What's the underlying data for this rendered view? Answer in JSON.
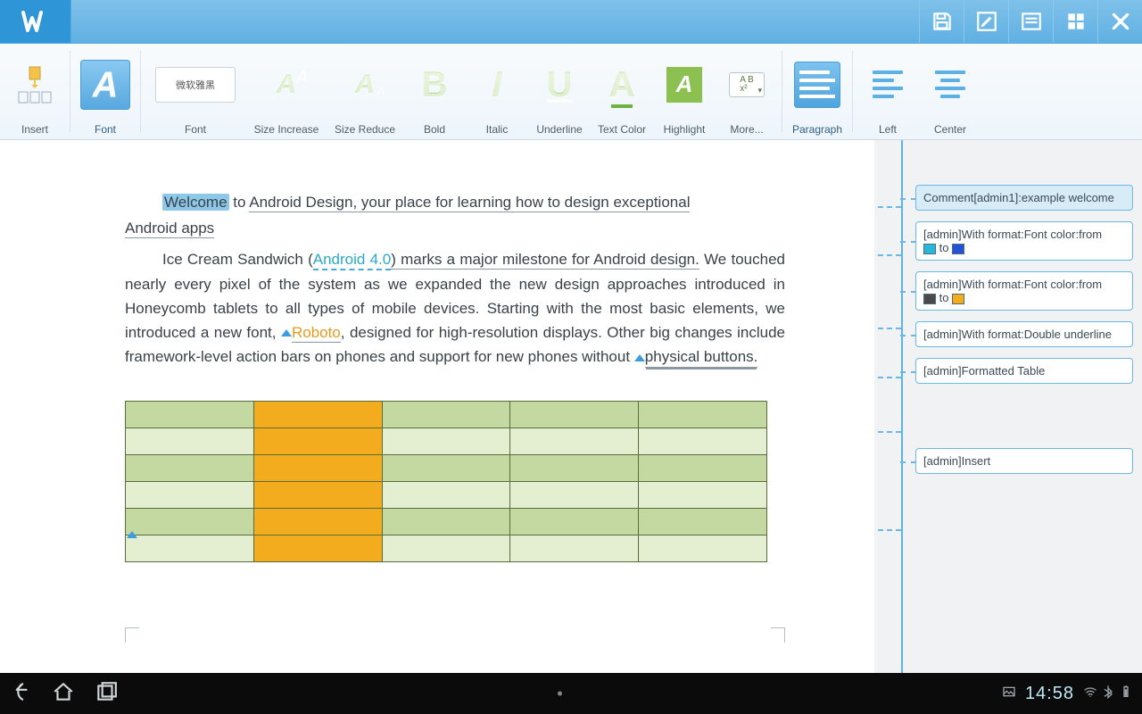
{
  "appbar": {
    "logo_label": "W"
  },
  "ribbon": {
    "insert": "Insert",
    "font_active": "Font",
    "font_select_value": "微软雅黑",
    "font": "Font",
    "size_increase": "Size Increase",
    "size_reduce": "Size Reduce",
    "bold": "Bold",
    "italic": "Italic",
    "underline": "Underline",
    "text_color": "Text Color",
    "highlight": "Highlight",
    "more": "More...",
    "paragraph": "Paragraph",
    "left": "Left",
    "center": "Center"
  },
  "doc": {
    "p1_welcome": "Welcome",
    "p1_rest1": " to ",
    "p1_android_design": "Android Design, your place for learning how to design exceptional",
    "p1_line2": "Android apps",
    "p2_pre": "Ice Cream Sandwich (",
    "p2_link": "Android 4.0",
    "p2_post1": ") marks a major milestone for Android design.",
    "p2_line2": "We touched nearly every pixel of the system as we expanded the new design approaches introduced in Honeycomb tablets to all types of mobile devices. Starting with the most basic elements, we introduced a new font, ",
    "p2_roboto": "Roboto",
    "p2_post2": ", designed for high-resolution displays. Other big changes include framework-level action bars on phones and support for new phones without ",
    "p2_physbtn": "physical buttons.",
    "table": {
      "rows": 6,
      "cols": 5
    }
  },
  "comments": {
    "c1": "Comment[admin1]:example welcome",
    "c2_a": "[admin]With format:Font color:from ",
    "c2_to": " to ",
    "c2_from_color": "#2ab5d9",
    "c2_to_color": "#2551d6",
    "c3_a": "[admin]With format:Font color:from ",
    "c3_to": " to ",
    "c3_from_color": "#4a4a4a",
    "c3_to_color": "#f2ac1e",
    "c4": "[admin]With format:Double underline",
    "c5": "[admin]Formatted Table",
    "c6": "[admin]Insert"
  },
  "status": {
    "clock": "14:58"
  }
}
